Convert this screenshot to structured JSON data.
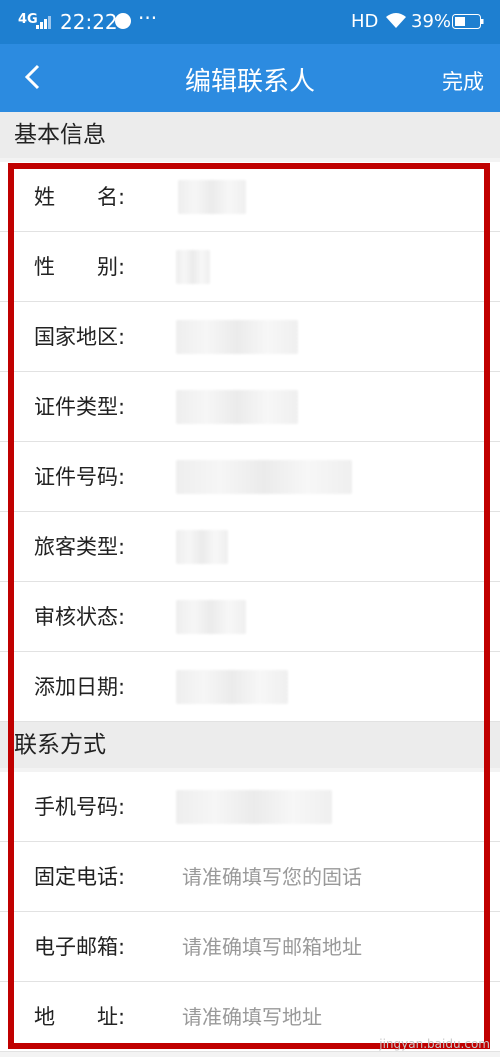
{
  "status": {
    "signal": "4G",
    "time": "22:22",
    "dots": "···",
    "hd": "HD",
    "battery": "39%"
  },
  "nav": {
    "title": "编辑联系人",
    "done": "完成"
  },
  "section_basic": "基本信息",
  "basic_rows": [
    {
      "label": "姓　　名:"
    },
    {
      "label": "性　　别:"
    },
    {
      "label": "国家地区:"
    },
    {
      "label": "证件类型:"
    },
    {
      "label": "证件号码:"
    },
    {
      "label": "旅客类型:"
    },
    {
      "label": "审核状态:"
    },
    {
      "label": "添加日期:"
    }
  ],
  "section_contact": "联系方式",
  "contact_rows": [
    {
      "label": "手机号码:",
      "placeholder": ""
    },
    {
      "label": "固定电话:",
      "placeholder": "请准确填写您的固话"
    },
    {
      "label": "电子邮箱:",
      "placeholder": "请准确填写邮箱地址"
    },
    {
      "label": "地　　址:",
      "placeholder": "请准确填写地址"
    }
  ],
  "watermark": "jingyan.baidu.com"
}
